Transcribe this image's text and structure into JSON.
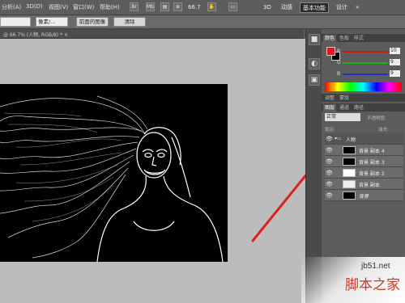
{
  "menubar": {
    "items": [
      "分析(A)",
      "3D(D)",
      "视图(V)",
      "窗口(W)",
      "帮助(H)"
    ],
    "br_label": "Br",
    "mb_label": "Mb",
    "zoom": "66.7",
    "workspaces": [
      "3D",
      "动感",
      "基本功能",
      "设计"
    ],
    "more": "»"
  },
  "options": {
    "unit_value": "像素/...",
    "front_image_label": "前面的图像",
    "clear_label": "清除"
  },
  "document": {
    "tab_title": "@ 66.7% (人物, RGB/8) * ×"
  },
  "color_panel": {
    "tabs": [
      "颜色",
      "色板",
      "样式"
    ],
    "foreground": "#e8141b",
    "background": "#000000",
    "sliders": [
      {
        "label": "R",
        "value": "10",
        "color": "#d81414"
      },
      {
        "label": "G",
        "value": "9",
        "color": "#17b617"
      },
      {
        "label": "B",
        "value": "9",
        "color": "#1c33cc"
      }
    ]
  },
  "adjust_panel": {
    "tabs": [
      "调整",
      "蒙版"
    ]
  },
  "layers_panel": {
    "tabs": [
      "图层",
      "通道",
      "路径"
    ],
    "blend_mode": "正常",
    "opacity_label": "不透明度:",
    "lock_label": "锁定:",
    "fill_label": "填充:",
    "layers": [
      {
        "name": "人物",
        "group": true
      },
      {
        "name": "背景 副本 4",
        "group": false
      },
      {
        "name": "背景 副本 3",
        "group": false
      },
      {
        "name": "背景 副本 2",
        "group": false
      },
      {
        "name": "背景 副本",
        "group": false
      },
      {
        "name": "背景",
        "group": false
      }
    ]
  },
  "watermark": {
    "url": "jb51.net",
    "name": "脚本之家"
  },
  "colors": {
    "arrow": "#e02020",
    "accent": "#2b2b2b"
  }
}
